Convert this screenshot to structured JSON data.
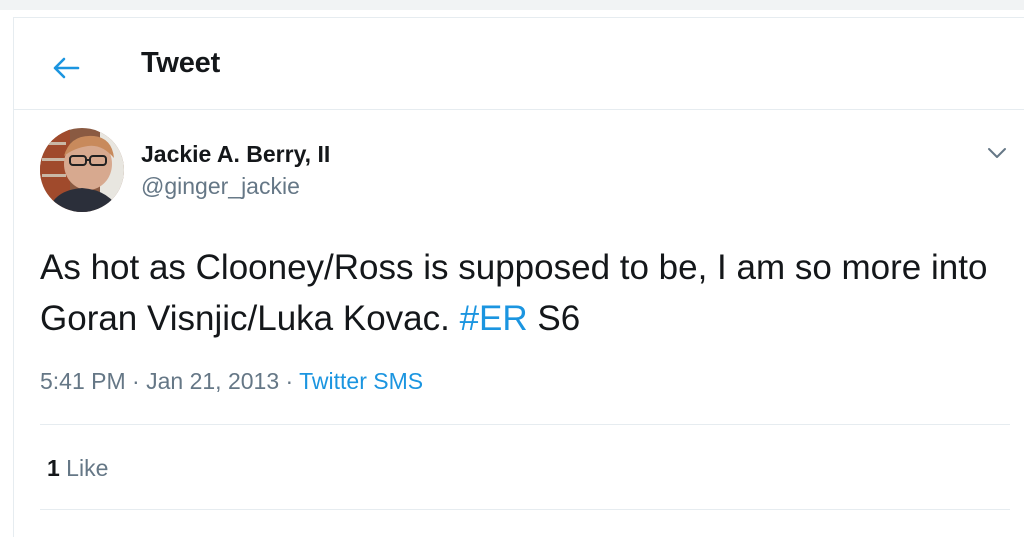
{
  "header": {
    "back_icon": "arrow-left-icon",
    "title": "Tweet"
  },
  "tweet": {
    "author": {
      "name": "Jackie A. Berry, II",
      "handle": "@ginger_jackie",
      "avatar": "avatar-photo"
    },
    "caret_icon": "chevron-down-icon",
    "text_before": "As hot as Clooney/Ross is supposed to be, I am so more into Goran Visnjic/Luka Kovac. ",
    "hashtag": "#ER",
    "text_after": " S6",
    "time": "5:41 PM",
    "separator": " · ",
    "date": "Jan 21, 2013",
    "source": "Twitter SMS",
    "likes_count": "1",
    "likes_label": " Like"
  },
  "colors": {
    "accent": "#1b95e0",
    "text": "#14171a",
    "secondary": "#657786",
    "border": "#e6ecf0"
  }
}
